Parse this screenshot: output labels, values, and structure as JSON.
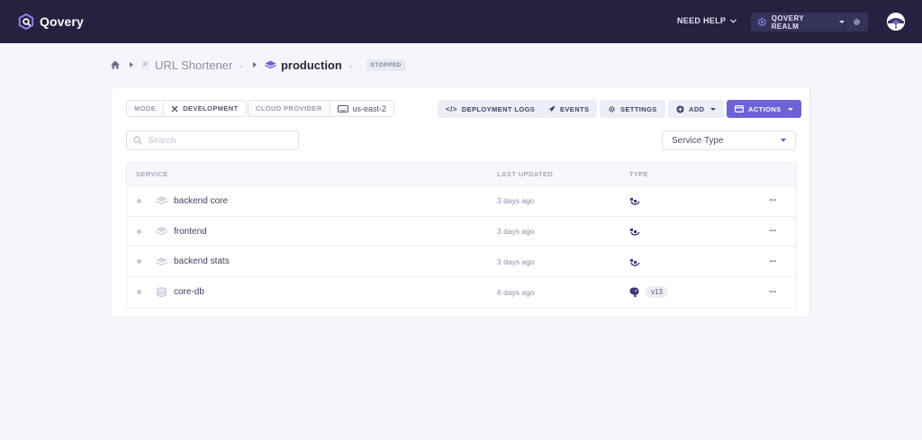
{
  "topbar": {
    "brand": "Qovery",
    "need_help": "NEED HELP",
    "org_name": "QOVERY REALM"
  },
  "breadcrumb": {
    "project_initial": "P",
    "project": "URL Shortener",
    "environment": "production",
    "status": "STOPPED"
  },
  "tags": {
    "mode_key": "MODE",
    "mode_value": "DEVELOPMENT",
    "provider_key": "CLOUD PROVIDER",
    "provider_value": "us-east-2"
  },
  "buttons": {
    "deployment_logs": "DEPLOYMENT LOGS",
    "events": "EVENTS",
    "settings": "SETTINGS",
    "add": "ADD",
    "actions": "ACTIONS"
  },
  "search": {
    "placeholder": "Search"
  },
  "filter": {
    "selected": "Service Type"
  },
  "table": {
    "headers": {
      "service": "SERVICE",
      "last_updated": "LAST UPDATED",
      "type": "TYPE"
    },
    "rows": [
      {
        "name": "backend core",
        "updated": "3 days ago",
        "icon": "application-icon",
        "type_icon": "container-icon",
        "version": ""
      },
      {
        "name": "frontend",
        "updated": "3 days ago",
        "icon": "application-icon",
        "type_icon": "container-icon",
        "version": ""
      },
      {
        "name": "backend stats",
        "updated": "3 days ago",
        "icon": "application-icon",
        "type_icon": "container-icon",
        "version": ""
      },
      {
        "name": "core-db",
        "updated": "6 days ago",
        "icon": "database-icon",
        "type_icon": "postgresql-icon",
        "version": "v13"
      }
    ],
    "row_menu": "···"
  },
  "colors": {
    "topbar": "#25223f",
    "accent": "#6d63d8",
    "background": "#f5f6fb"
  }
}
